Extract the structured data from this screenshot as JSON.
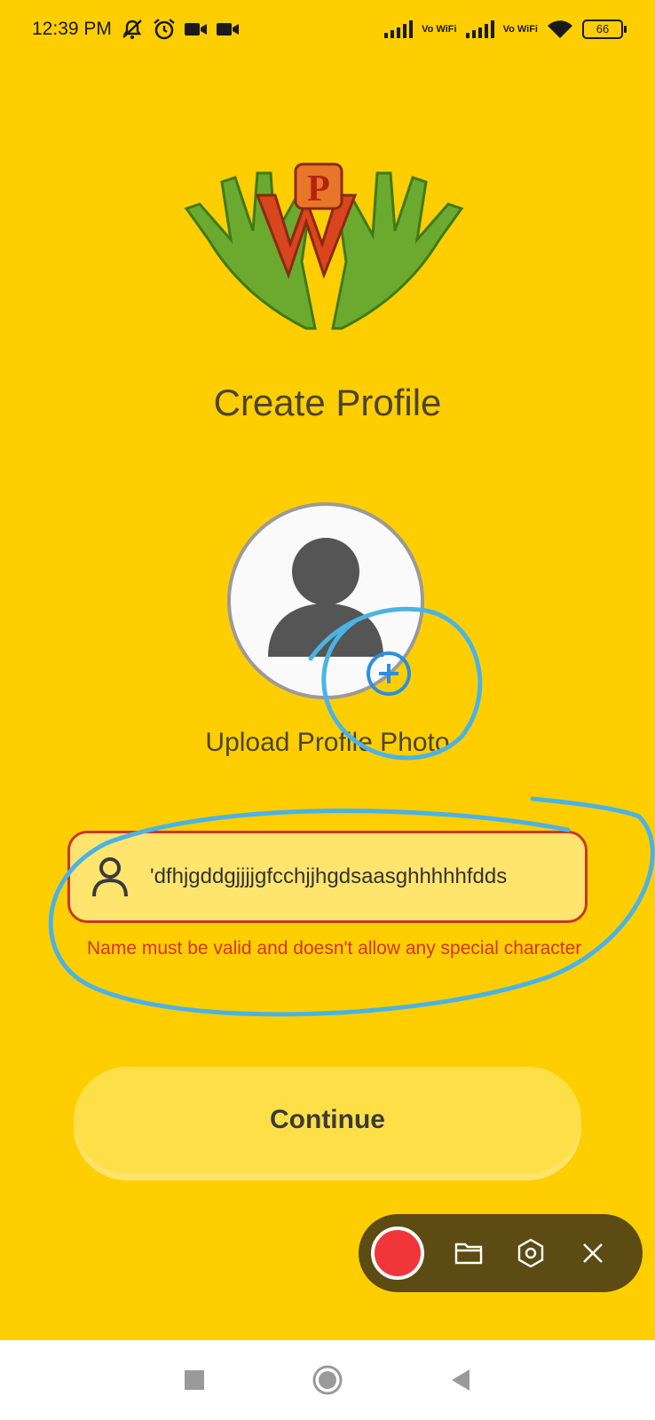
{
  "status_bar": {
    "time": "12:39 PM",
    "icons": [
      "mute-icon",
      "alarm-icon",
      "video-camera-icon",
      "video-camera-icon"
    ],
    "volte_label": "Vo WiFi",
    "battery": "66"
  },
  "logo": {
    "letter": "P",
    "icon": "waving-hands-logo"
  },
  "title": "Create Profile",
  "avatar": {
    "icon": "person-icon",
    "add_icon": "plus-circle-icon"
  },
  "upload_label": "Upload Profile Photo",
  "name_field": {
    "value": "'dfhjgddgjjjjgfcchjjhgdsaasghhhhhfdds",
    "icon": "person-outline-icon"
  },
  "error_message": "Name must be valid and doesn't allow any special character",
  "continue_label": "Continue",
  "recorder": {
    "icons": [
      "record-icon",
      "folder-icon",
      "settings-hex-icon",
      "close-icon"
    ]
  },
  "nav": {
    "icons": [
      "recents-square-icon",
      "home-circle-icon",
      "back-triangle-icon"
    ]
  },
  "colors": {
    "background": "#FFCE00",
    "error": "#D0352E",
    "field_bg": "#FFE46E",
    "button_bg": "#FFDF48",
    "annotation": "#4AB3E6"
  }
}
